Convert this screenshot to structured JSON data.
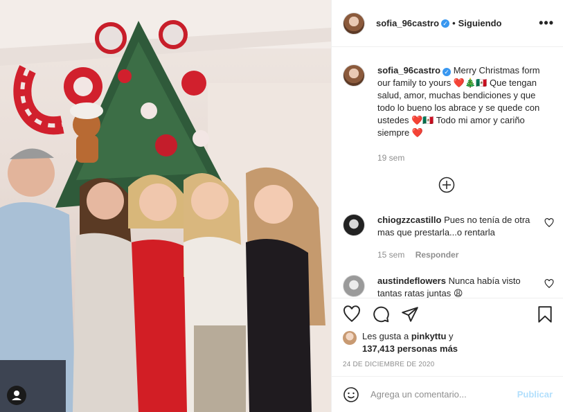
{
  "post": {
    "username": "sofia_96castro",
    "verified_mark": "✓",
    "dot": "•",
    "follow_status": "Siguiendo",
    "more_glyph": "•••"
  },
  "caption": {
    "username": "sofia_96castro",
    "text": "Merry Christmas form our family to yours ❤️🎄🇲🇽 Que tengan salud, amor, muchas bendiciones y que todo lo bueno los abrace y se quede con ustedes ❤️🇲🇽 Todo mi amor y cariño siempre ❤️",
    "time": "19 sem"
  },
  "comments": [
    {
      "username": "chiogzzcastillo",
      "text": "Pues no tenía de otra mas que prestarla...o rentarla",
      "time": "15 sem",
      "reply_label": "Responder"
    },
    {
      "username": "austindeflowers",
      "text": "Nunca había visto tantas ratas juntas 😩",
      "time": "",
      "reply_label": ""
    }
  ],
  "likes": {
    "prefix": "Les gusta a",
    "user": "pinkyttu",
    "connector": "y",
    "others": "137,413 personas más"
  },
  "date": "24 DE DICIEMBRE DE 2020",
  "composer": {
    "placeholder": "Agrega un comentario...",
    "publish_label": "Publicar"
  },
  "icons": {
    "like": "heart-icon",
    "comment": "comment-icon",
    "share": "paper-plane-icon",
    "save": "bookmark-icon",
    "load_more": "plus-circle-icon",
    "emoji": "smiley-icon",
    "tagged": "user-tag-icon"
  },
  "colors": {
    "accent": "#3897f0",
    "publish_disabled": "#b2dffc",
    "muted": "#8e8e8e",
    "heart_red": "#ed4956"
  }
}
